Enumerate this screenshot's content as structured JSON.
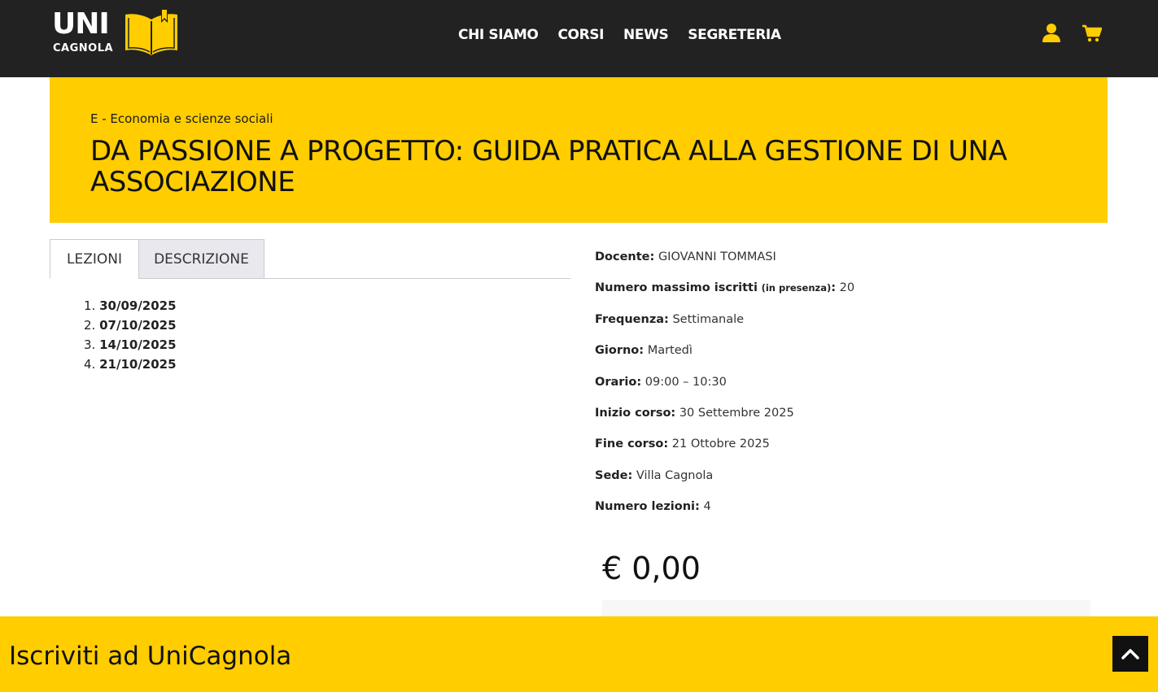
{
  "header": {
    "logo_main": "UNI",
    "logo_sub": "CAGNOLA",
    "nav": [
      "CHI SIAMO",
      "CORSI",
      "NEWS",
      "SEGRETERIA"
    ],
    "icons": [
      "user-icon",
      "cart-icon"
    ]
  },
  "hero": {
    "category": "E - Economia e scienze sociali",
    "title": "DA PASSIONE A PROGETTO: GUIDA PRATICA ALLA GESTIONE DI UNA ASSOCIAZIONE"
  },
  "tabs": {
    "lezioni": "LEZIONI",
    "descrizione": "DESCRIZIONE"
  },
  "lessons": [
    {
      "num": "1.",
      "date": "30/09/2025"
    },
    {
      "num": "2.",
      "date": "07/10/2025"
    },
    {
      "num": "3.",
      "date": "14/10/2025"
    },
    {
      "num": "4.",
      "date": "21/10/2025"
    }
  ],
  "details": {
    "docente_k": "Docente:",
    "docente_v": "GIOVANNI TOMMASI",
    "iscritti_k": "Numero massimo iscritti",
    "iscritti_small": "(in presenza)",
    "iscritti_colon": ":",
    "iscritti_v": "20",
    "frequenza_k": "Frequenza:",
    "frequenza_v": "Settimanale",
    "giorno_k": "Giorno:",
    "giorno_v": "Martedì",
    "orario_k": "Orario:",
    "orario_v": "09:00 – 10:30",
    "inizio_k": "Inizio corso:",
    "inizio_v": "30 Settembre 2025",
    "fine_k": "Fine corso:",
    "fine_v": "21 Ottobre 2025",
    "sede_k": "Sede:",
    "sede_v": "Villa Cagnola",
    "lezioni_k": "Numero lezioni:",
    "lezioni_v": "4"
  },
  "price": "€ 0,00",
  "footer": {
    "title": "Iscriviti ad UniCagnola"
  },
  "colors": {
    "brand_yellow": "#ffcd00",
    "header_dark": "#222222"
  }
}
